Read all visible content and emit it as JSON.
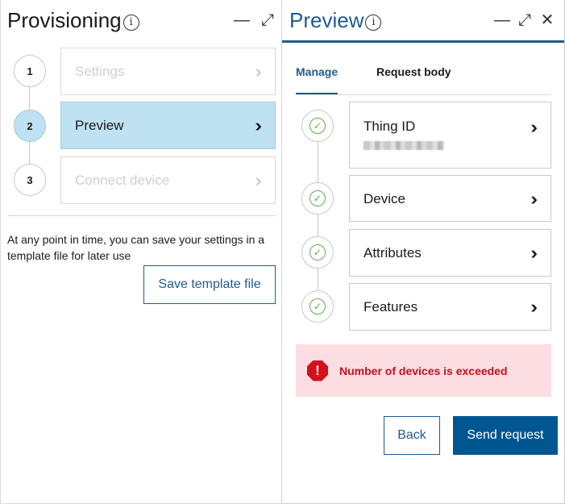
{
  "left": {
    "title": "Provisioning",
    "info_glyph": "i",
    "minimize_glyph": "—",
    "expand_glyph": "⤢",
    "steps": [
      {
        "number": "1",
        "label": "Settings",
        "chevron": "››",
        "state": "disabled"
      },
      {
        "number": "2",
        "label": "Preview",
        "chevron": "››",
        "state": "active"
      },
      {
        "number": "3",
        "label": "Connect device",
        "chevron": "››",
        "state": "disabled"
      }
    ],
    "hint": "At any point in time, you can save your settings in a template file for later use",
    "save_template_label": "Save template file"
  },
  "right": {
    "title": "Preview",
    "info_glyph": "i",
    "minimize_glyph": "—",
    "expand_glyph": "⤢",
    "close_glyph": "✕",
    "tabs": [
      {
        "label": "Manage",
        "active": true
      },
      {
        "label": "Request body",
        "active": false
      }
    ],
    "sections": [
      {
        "label": "Thing ID",
        "chevron": "››",
        "check": "✓"
      },
      {
        "label": "Device",
        "chevron": "››",
        "check": "✓"
      },
      {
        "label": "Attributes",
        "chevron": "››",
        "check": "✓"
      },
      {
        "label": "Features",
        "chevron": "››",
        "check": "✓"
      }
    ],
    "alert": {
      "icon_glyph": "!",
      "message": "Number of devices is exceeded"
    },
    "back_label": "Back",
    "send_label": "Send request"
  },
  "colors": {
    "accent": "#1f5a94",
    "active_step": "#bfe2f2",
    "success": "#5aae4a",
    "error_bg": "#fcdde2",
    "error": "#d4101a",
    "primary_button": "#005691"
  },
  "icons": [
    "info-icon",
    "minimize-icon",
    "expand-icon",
    "close-icon",
    "chevron-double-right-icon",
    "check-circle-icon",
    "alert-octagon-icon"
  ]
}
